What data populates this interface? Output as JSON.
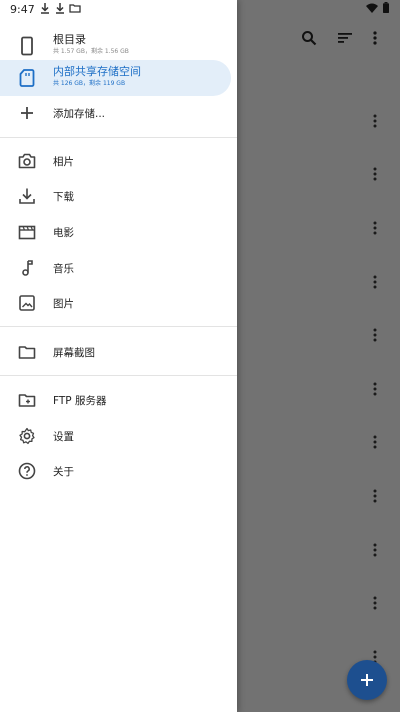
{
  "status_bar": {
    "time": "9:47"
  },
  "drawer": {
    "storage_items": [
      {
        "label": "根目录",
        "sub": "共 1.57 GB，剩余 1.56 GB",
        "icon": "phone-icon"
      },
      {
        "label": "内部共享存储空间",
        "sub": "共 126 GB，剩余 119 GB",
        "icon": "sd-card-icon",
        "selected": true
      },
      {
        "label": "添加存储...",
        "icon": "plus-icon"
      }
    ],
    "folder_items": [
      {
        "label": "相片",
        "icon": "camera-icon"
      },
      {
        "label": "下载",
        "icon": "download-icon"
      },
      {
        "label": "电影",
        "icon": "movie-icon"
      },
      {
        "label": "音乐",
        "icon": "music-note-icon"
      },
      {
        "label": "图片",
        "icon": "image-icon"
      }
    ],
    "bookmark_items": [
      {
        "label": "屏幕截图",
        "icon": "folder-icon"
      }
    ],
    "other_items": [
      {
        "label": "FTP 服务器",
        "icon": "ftp-folder-icon"
      },
      {
        "label": "设置",
        "icon": "gear-icon"
      },
      {
        "label": "关于",
        "icon": "help-circle-icon"
      }
    ]
  },
  "toolbar_icons": [
    "search-icon",
    "sort-icon",
    "more-vert-icon"
  ],
  "colors": {
    "accent": "#1e6fc6",
    "selected_bg": "#e3eef9",
    "fab": "#1d4f8f",
    "scrim": "#727272"
  }
}
